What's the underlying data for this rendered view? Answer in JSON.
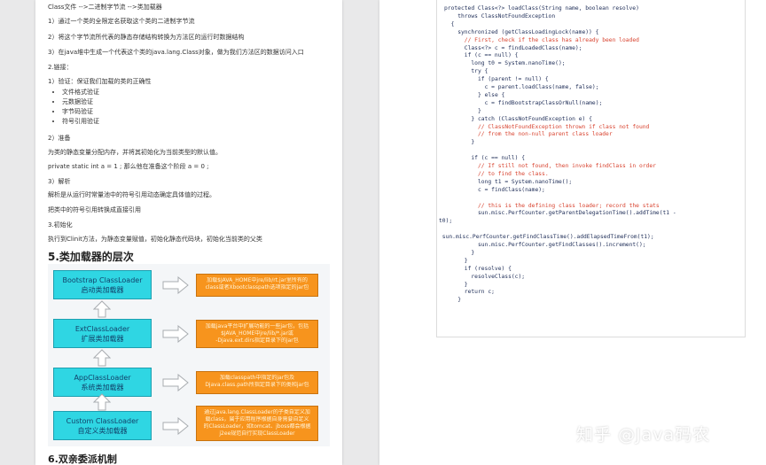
{
  "left_page": {
    "heading": "Class文件 -->二进制字节流 -->类加载器",
    "steps": [
      "1）通过一个类的全限定名获取这个类的二进制字节流",
      "2）将这个字节流所代表的静态存储结构转换为方法区的运行时数据结构",
      "3）在java堆中生成一个代表这个类的java.lang.Class对象，做为我们方法区的数据访问入口"
    ],
    "link_title": "2.链接：",
    "verify_title": "1）验证：保证我们加载的类的正确性",
    "verify_items": [
      "文件格式验证",
      "元数据验证",
      "字节码验证",
      "符号引用验证"
    ],
    "prepare_title": "2）准备",
    "prepare_text": "为类的静态变量分配内存，并将其初始化为当前类型的默认值。",
    "code_sample": "private   static  int  a   = 1 ;       那么他在准备这个阶段  a = 0 ;",
    "resolve_title": "3）解析",
    "resolve_text1": "解析是从运行时常量池中的符号引用动态确定具体值的过程。",
    "resolve_text2": "把类中的符号引用转换成直接引用",
    "init_title": "3.初始化",
    "init_text": "执行到Clinit方法，为静态变量赋值，初始化静态代码块，初始化当前类的父类",
    "section5_title": "5.类加载器的层次",
    "section6_title": "6.双亲委派机制"
  },
  "diagram": {
    "loaders": [
      {
        "name": "Bootstrap ClassLoader",
        "cn": "启动类加载器"
      },
      {
        "name": "ExtClassLoader",
        "cn": "扩展类加载器"
      },
      {
        "name": "AppClassLoader",
        "cn": "系统类加载器"
      },
      {
        "name": "Custom  ClassLoader",
        "cn": "自定义类加载器"
      }
    ],
    "descriptions": [
      [
        "加载$JAVA_HOME中jre/lib/rt.jar里所有的",
        "class或者Xbootclasspath选项指定的jar包"
      ],
      [
        "加载java平台中扩展功能的一些jar包，包括",
        "$JAVA_HOME中jre/lib/*.jar或",
        "-Djava.ext.dirs指定目录下的jar包"
      ],
      [
        "加载classpath中指定的jar包及",
        "Djava.class.path所指定目录下的类和jar包"
      ],
      [
        "通过java.lang.ClassLoader的子类自定义加",
        "载class，属于应用程序根据自身需要自定义",
        "的ClassLoader，如tomcat、jboss都会根据",
        "j2ee规范自行实现ClassLoader"
      ]
    ],
    "colors": {
      "loader": "#2fd6e3",
      "description": "#f7941d",
      "arrow": "#b0b4b8"
    }
  },
  "code": [
    {
      "indent": 0,
      "type": "kw",
      "text": "protected Class<?> loadClass(String name, boolean resolve)"
    },
    {
      "indent": 4,
      "type": "kw",
      "text": "throws ClassNotFoundException"
    },
    {
      "indent": 2,
      "type": "kw",
      "text": "{"
    },
    {
      "indent": 4,
      "type": "kw",
      "text": "synchronized (getClassLoadingLock(name)) {"
    },
    {
      "indent": 6,
      "type": "comment",
      "text": "// First, check if the class has already been loaded"
    },
    {
      "indent": 6,
      "type": "kw",
      "text": "Class<?> c = findLoadedClass(name);"
    },
    {
      "indent": 6,
      "type": "kw",
      "text": "if (c == null) {"
    },
    {
      "indent": 8,
      "type": "kw",
      "text": "long t0 = System.nanoTime();"
    },
    {
      "indent": 8,
      "type": "kw",
      "text": "try {"
    },
    {
      "indent": 10,
      "type": "kw",
      "text": "if (parent != null) {"
    },
    {
      "indent": 12,
      "type": "kw",
      "text": "c = parent.loadClass(name, false);"
    },
    {
      "indent": 10,
      "type": "kw",
      "text": "} else {"
    },
    {
      "indent": 12,
      "type": "kw",
      "text": "c = findBootstrapClassOrNull(name);"
    },
    {
      "indent": 10,
      "type": "kw",
      "text": "}"
    },
    {
      "indent": 8,
      "type": "kw",
      "text": "} catch (ClassNotFoundException e) {"
    },
    {
      "indent": 10,
      "type": "comment",
      "text": "// ClassNotFoundException thrown if class not found"
    },
    {
      "indent": 10,
      "type": "comment",
      "text": "// from the non-null parent class loader"
    },
    {
      "indent": 8,
      "type": "kw",
      "text": "}"
    },
    {
      "indent": 0,
      "type": "kw",
      "text": ""
    },
    {
      "indent": 8,
      "type": "kw",
      "text": "if (c == null) {"
    },
    {
      "indent": 10,
      "type": "comment",
      "text": "// If still not found, then invoke findClass in order"
    },
    {
      "indent": 10,
      "type": "comment",
      "text": "// to find the class."
    },
    {
      "indent": 10,
      "type": "kw",
      "text": "long t1 = System.nanoTime();"
    },
    {
      "indent": 10,
      "type": "kw",
      "text": "c = findClass(name);"
    },
    {
      "indent": 0,
      "type": "kw",
      "text": ""
    },
    {
      "indent": 10,
      "type": "comment",
      "text": "// this is the defining class loader; record the stats"
    },
    {
      "indent": 10,
      "type": "kw",
      "text": "sun.misc.PerfCounter.getParentDelegationTime().addTime(t1 -"
    },
    {
      "indent": -1,
      "type": "kw",
      "text": "t0);"
    },
    {
      "indent": 0,
      "type": "kw",
      "text": ""
    },
    {
      "indent": -1,
      "type": "kw",
      "text": " sun.misc.PerfCounter.getFindClassTime().addElapsedTimeFrom(t1);"
    },
    {
      "indent": 10,
      "type": "kw",
      "text": "sun.misc.PerfCounter.getFindClasses().increment();"
    },
    {
      "indent": 8,
      "type": "kw",
      "text": "}"
    },
    {
      "indent": 6,
      "type": "kw",
      "text": "}"
    },
    {
      "indent": 6,
      "type": "kw",
      "text": "if (resolve) {"
    },
    {
      "indent": 8,
      "type": "kw",
      "text": "resolveClass(c);"
    },
    {
      "indent": 6,
      "type": "kw",
      "text": "}"
    },
    {
      "indent": 6,
      "type": "kw",
      "text": "return c;"
    },
    {
      "indent": 4,
      "type": "kw",
      "text": "}"
    }
  ],
  "watermark": "知乎 @Java码农"
}
